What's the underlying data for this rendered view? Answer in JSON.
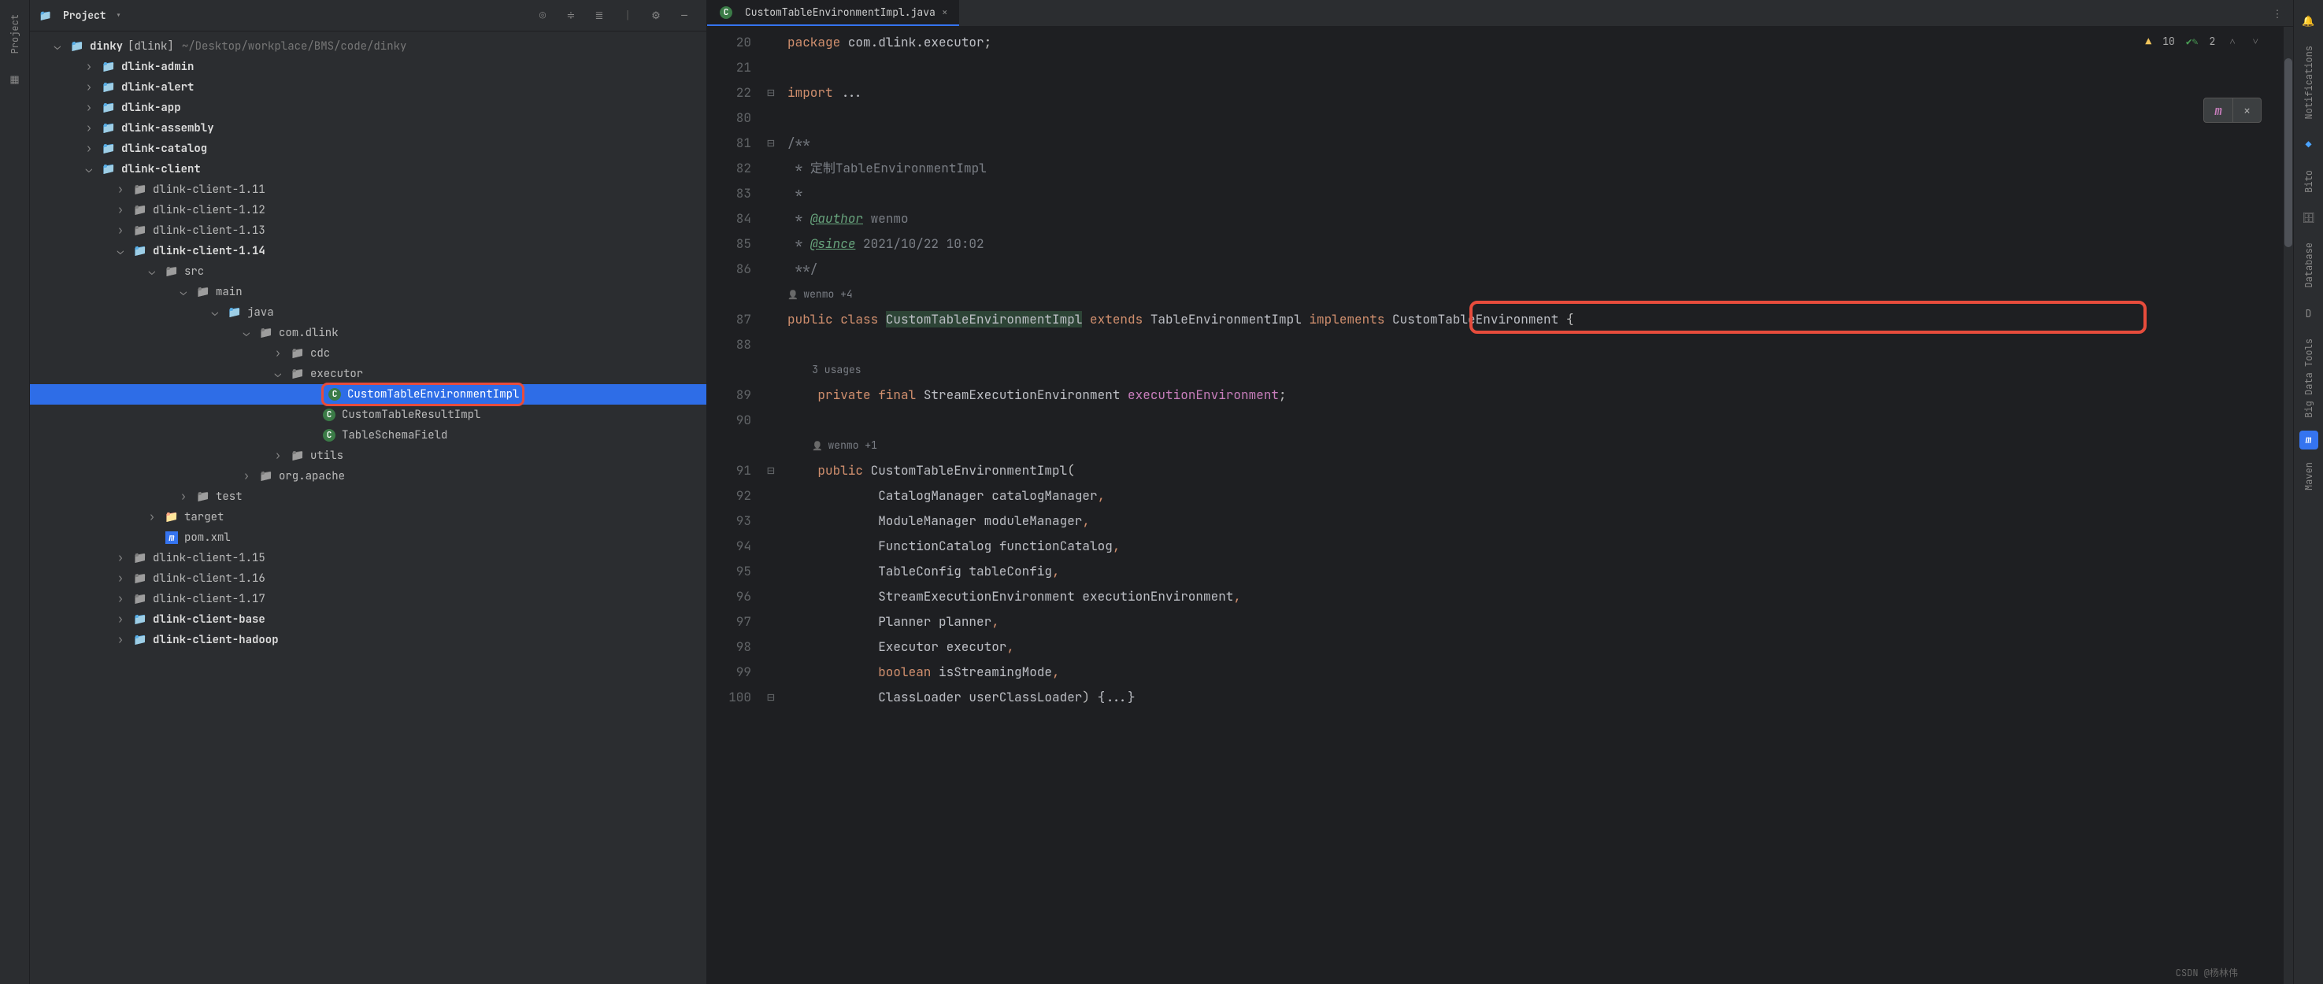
{
  "panel": {
    "title": "Project"
  },
  "root_project": {
    "name": "dinky",
    "bracket": "[dlink]",
    "path": "~/Desktop/workplace/BMS/code/dinky"
  },
  "tree": {
    "dlink_admin": "dlink-admin",
    "dlink_alert": "dlink-alert",
    "dlink_app": "dlink-app",
    "dlink_assembly": "dlink-assembly",
    "dlink_catalog": "dlink-catalog",
    "dlink_client": "dlink-client",
    "client_111": "dlink-client-1.11",
    "client_112": "dlink-client-1.12",
    "client_113": "dlink-client-1.13",
    "client_114": "dlink-client-1.14",
    "src": "src",
    "main": "main",
    "java": "java",
    "com_dlink": "com.dlink",
    "cdc": "cdc",
    "executor": "executor",
    "ctei": "CustomTableEnvironmentImpl",
    "ctri": "CustomTableResultImpl",
    "tsf": "TableSchemaField",
    "utils": "utils",
    "org_apache": "org.apache",
    "test": "test",
    "target": "target",
    "pom": "pom.xml",
    "client_115": "dlink-client-1.15",
    "client_116": "dlink-client-1.16",
    "client_117": "dlink-client-1.17",
    "client_base": "dlink-client-base",
    "client_hadoop": "dlink-client-hadoop"
  },
  "tab": {
    "name": "CustomTableEnvironmentImpl.java"
  },
  "badges": {
    "warn_count": "10",
    "check_count": "2"
  },
  "watermark": "CSDN @杨林伟",
  "right_strip": {
    "n0": "Notifications",
    "n1": "Bito",
    "n2": "Database",
    "n3": "Big Data Tools",
    "n4": "Maven"
  },
  "gutter": [
    "20",
    "21",
    "22",
    "80",
    "81",
    "82",
    "83",
    "84",
    "85",
    "86",
    "",
    "87",
    "88",
    "",
    "89",
    "90",
    "",
    "91",
    "92",
    "93",
    "94",
    "95",
    "96",
    "97",
    "98",
    "99",
    "100"
  ],
  "fold": [
    "",
    "",
    "⊟",
    "",
    "⊟",
    "",
    "",
    "",
    "",
    "",
    "",
    "",
    "",
    "",
    "",
    "",
    "",
    "⊟",
    "",
    "",
    "",
    "",
    "",
    "",
    "",
    "",
    "⊟"
  ],
  "code": {
    "l0_pkg_kw": "package ",
    "l0_pkg": "com.dlink.executor",
    "l0_semi": ";",
    "l2_kw": "import ",
    "l2_rest": "...",
    "l4": "/**",
    "l5_star": " * ",
    "l5_txt": "定制TableEnvironmentImpl",
    "l6": " *",
    "l7_star": " * ",
    "l7_tag": "@author",
    "l7_val": " wenmo",
    "l8_star": " * ",
    "l8_tag": "@since",
    "l8_val": " 2021/10/22 10:02",
    "l9": " **/",
    "hint1": "wenmo +4",
    "l11_pub": "public ",
    "l11_cls": "class ",
    "l11_name": "CustomTableEnvironmentImpl",
    "l11_ext": " extends ",
    "l11_sup": "TableEnvironmentImpl",
    "l11_impl": " implements ",
    "l11_if": "CustomTableEnvironment",
    "l11_brace": " {",
    "usages": "3 usages",
    "l14_mods": "private final ",
    "l14_type": "StreamExecutionEnvironment ",
    "l14_field": "executionEnvironment",
    "l14_semi": ";",
    "hint2": "wenmo +1",
    "l17_pub": "public ",
    "l17_name": "CustomTableEnvironmentImpl",
    "l17_paren": "(",
    "l18_t": "CatalogManager ",
    "l18_n": "catalogManager",
    "l18_c": ",",
    "l19_t": "ModuleManager ",
    "l19_n": "moduleManager",
    "l19_c": ",",
    "l20_t": "FunctionCatalog ",
    "l20_n": "functionCatalog",
    "l20_c": ",",
    "l21_t": "TableConfig ",
    "l21_n": "tableConfig",
    "l21_c": ",",
    "l22_t": "StreamExecutionEnvironment ",
    "l22_n": "executionEnvironment",
    "l22_c": ",",
    "l23_t": "Planner ",
    "l23_n": "planner",
    "l23_c": ",",
    "l24_t": "Executor ",
    "l24_n": "executor",
    "l24_c": ",",
    "l25_t": "boolean ",
    "l25_n": "isStreamingMode",
    "l25_c": ",",
    "l26_t": "ClassLoader ",
    "l26_n": "userClassLoader",
    "l26_c": ") ",
    "l26_fold": "{...}"
  }
}
